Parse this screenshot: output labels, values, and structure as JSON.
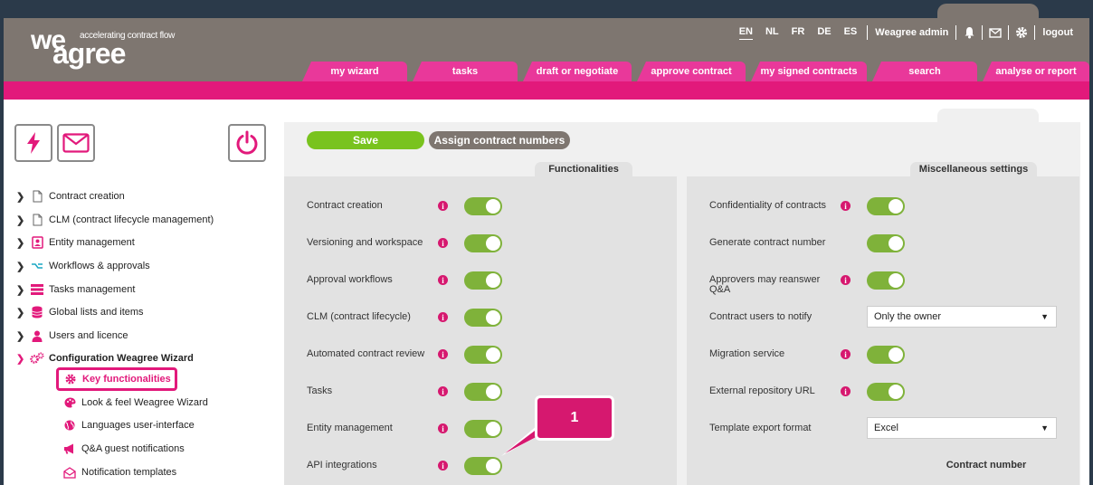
{
  "logo": {
    "we": "we",
    "agree": "agree",
    "tagline": "accelerating contract flow"
  },
  "languages": [
    "EN",
    "NL",
    "FR",
    "DE",
    "ES"
  ],
  "active_language": "EN",
  "user": "Weagree admin",
  "logout": "logout",
  "nav_tabs": [
    "my wizard",
    "tasks",
    "draft or negotiate",
    "approve contract",
    "my signed contracts",
    "search",
    "analyse or report"
  ],
  "toolbar": {
    "save": "Save",
    "assign": "Assign contract numbers"
  },
  "sidebar": {
    "items": [
      {
        "label": "Contract creation",
        "icon": "document-icon"
      },
      {
        "label": "CLM (contract lifecycle management)",
        "icon": "document-icon"
      },
      {
        "label": "Entity management",
        "icon": "entity-icon"
      },
      {
        "label": "Workflows & approvals",
        "icon": "workflow-icon"
      },
      {
        "label": "Tasks management",
        "icon": "tasks-icon"
      },
      {
        "label": "Global lists and items",
        "icon": "database-icon"
      },
      {
        "label": "Users and licence",
        "icon": "user-icon"
      },
      {
        "label": "Configuration Weagree Wizard",
        "icon": "gears-icon"
      }
    ],
    "subitems": [
      {
        "label": "Key functionalities",
        "icon": "gear-icon"
      },
      {
        "label": "Look & feel Weagree Wizard",
        "icon": "palette-icon"
      },
      {
        "label": "Languages user-interface",
        "icon": "globe-icon"
      },
      {
        "label": "Q&A guest notifications",
        "icon": "megaphone-icon"
      },
      {
        "label": "Notification templates",
        "icon": "envelope-open-icon"
      }
    ]
  },
  "functionalities": {
    "title": "Functionalities",
    "rows": [
      "Contract creation",
      "Versioning and workspace",
      "Approval workflows",
      "CLM (contract lifecycle)",
      "Automated contract review",
      "Tasks",
      "Entity management",
      "API integrations"
    ]
  },
  "misc": {
    "title": "Miscellaneous settings",
    "rows": [
      {
        "label": "Confidentiality of contracts",
        "info": true,
        "type": "toggle"
      },
      {
        "label": "Generate contract number",
        "info": false,
        "type": "toggle"
      },
      {
        "label": "Approvers may reanswer Q&A",
        "info": true,
        "type": "toggle"
      },
      {
        "label": "Contract users to notify",
        "info": false,
        "type": "select",
        "value": "Only the owner"
      },
      {
        "label": "Migration service",
        "info": true,
        "type": "toggle"
      },
      {
        "label": "External repository URL",
        "info": true,
        "type": "toggle"
      },
      {
        "label": "Template export format",
        "info": false,
        "type": "select",
        "value": "Excel"
      }
    ]
  },
  "contract_number_title": "Contract number",
  "callout": "1",
  "colors": {
    "brand_pink": "#e2197b",
    "header_gray": "#7e7670",
    "toggle_green": "#7fb23a",
    "save_green": "#79c31e"
  }
}
